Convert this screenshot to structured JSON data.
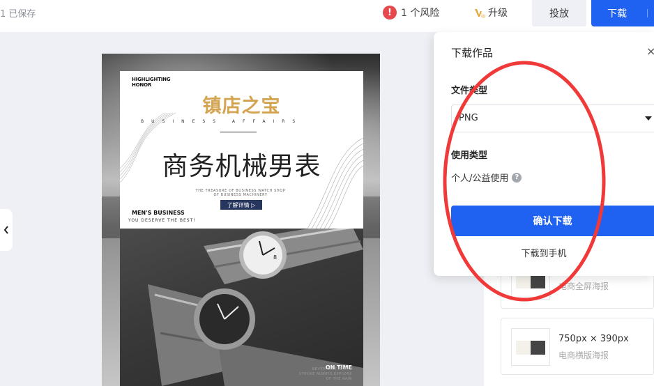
{
  "topbar": {
    "saved_text": "1 已保存",
    "risk_icon_text": "!",
    "risk_text": "1 个风险",
    "upgrade_text": "升级",
    "publish_label": "投放",
    "download_label": "下载"
  },
  "poster": {
    "honor_text": "HIGHLIGHTING HONOR",
    "gold_title": "镇店之宝",
    "spaced_text": "BUSINESS AFFAIRS",
    "main_title": "商务机械男表",
    "fine_text": "THE TREASURE OF BUSINESS WATCH SHOP OF BUSINESS MACHINERY",
    "button_label": "了解详情 ▷",
    "mens_business": "MEN'S BUSINESS",
    "deserve_text": "YOU DESERVE THE BEST!",
    "on_time": "ON TIME",
    "on_time_sub": "NEVER GIVE IN THE STROKE ALWAYS EXPLORE OF THE RAIN"
  },
  "download_panel": {
    "title": "下载作品",
    "close_glyph": "×",
    "file_type_label": "文件类型",
    "file_type_value": "PNG",
    "usage_type_label": "使用类型",
    "usage_value": "个人/公益使用",
    "help_glyph": "?",
    "confirm_label": "确认下载",
    "phone_label": "下载到手机"
  },
  "templates": [
    {
      "size": "",
      "type": "电商全屏海报"
    },
    {
      "size": "750px × 390px",
      "type": "电商横版海报"
    }
  ],
  "colors": {
    "primary": "#1f61f0",
    "gold": "#d4a451",
    "risk_red": "#e5484d",
    "annotation_red": "#f03a3a"
  }
}
